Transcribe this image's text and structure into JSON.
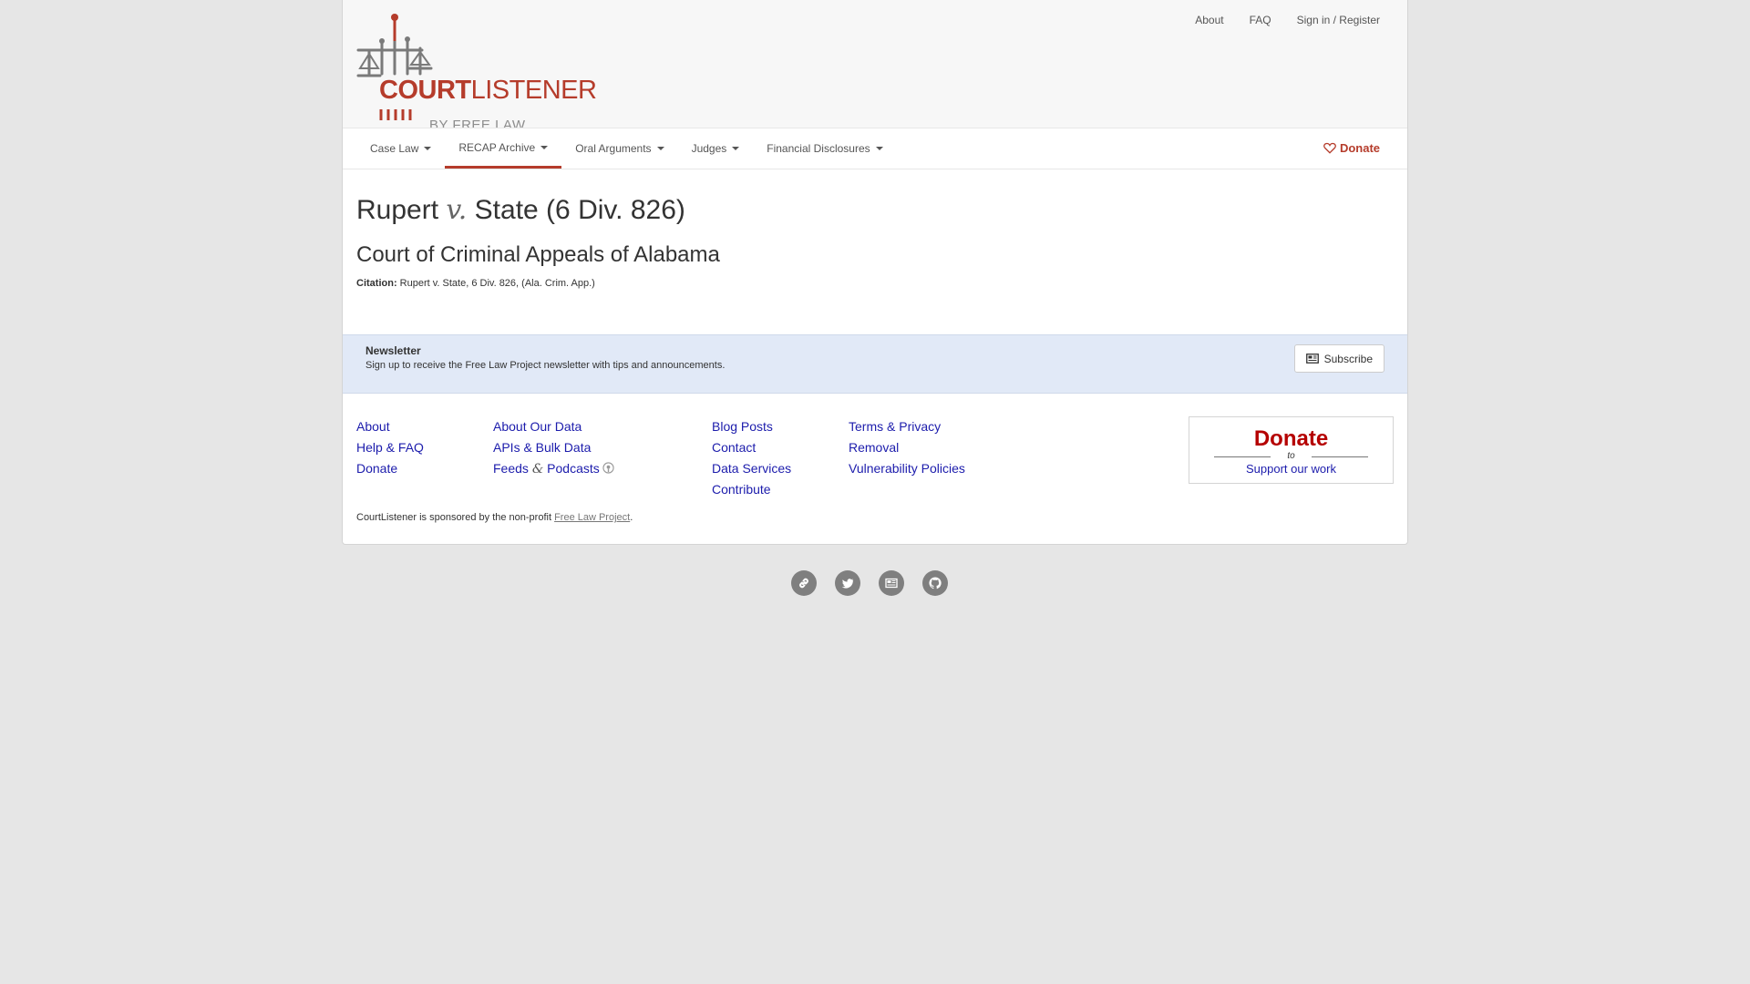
{
  "header": {
    "logo": {
      "word1": "COURT",
      "word2": "LISTENER",
      "subtitle": "BY FREE.LAW"
    },
    "top_links": [
      "About",
      "FAQ",
      "Sign in / Register"
    ]
  },
  "nav": {
    "items": [
      {
        "label": "Case Law",
        "icon": "caret-down-icon"
      },
      {
        "label": "RECAP Archive",
        "icon": "caret-down-icon",
        "active": true
      },
      {
        "label": "Oral Arguments",
        "icon": "caret-down-icon"
      },
      {
        "label": "Judges",
        "icon": "caret-down-icon"
      },
      {
        "label": "Financial Disclosures",
        "icon": "caret-down-icon"
      }
    ],
    "donate_label": "Donate"
  },
  "case": {
    "title_a": "Rupert",
    "title_vs": "v.",
    "title_b": "State (6 Div. 826)",
    "court": "Court of Criminal Appeals of Alabama",
    "citation_label": "Citation:",
    "citation_value": "Rupert v. State, 6 Div. 826, (Ala. Crim. App.)"
  },
  "newsletter": {
    "title": "Newsletter",
    "text": "Sign up to receive the Free Law Project newsletter with tips and announcements.",
    "button": "Subscribe"
  },
  "footer": {
    "col1": [
      "About",
      "Help & FAQ",
      "Donate"
    ],
    "col2": {
      "about_data": "About Our Data",
      "apis": "APIs & Bulk Data",
      "feeds": "Feeds",
      "amp": "&",
      "podcasts": "Podcasts"
    },
    "col3": [
      "Blog Posts",
      "Contact",
      "Data Services",
      "Contribute"
    ],
    "col4": [
      "Terms & Privacy",
      "Removal",
      "Vulnerability Policies"
    ],
    "donate_box": {
      "big": "Donate",
      "to": "to",
      "support": "Support our work"
    },
    "sponsor_text": "CourtListener is sponsored by the non-profit ",
    "sponsor_link": "Free Law Project",
    "sponsor_end": "."
  },
  "social": [
    "link-icon",
    "twitter-icon",
    "newsletter-icon",
    "github-icon"
  ],
  "colors": {
    "brand": "#b53c2b",
    "link": "#1c1cac",
    "donate_red": "#b50000",
    "newsletter_bg": "#e1e9f7"
  }
}
